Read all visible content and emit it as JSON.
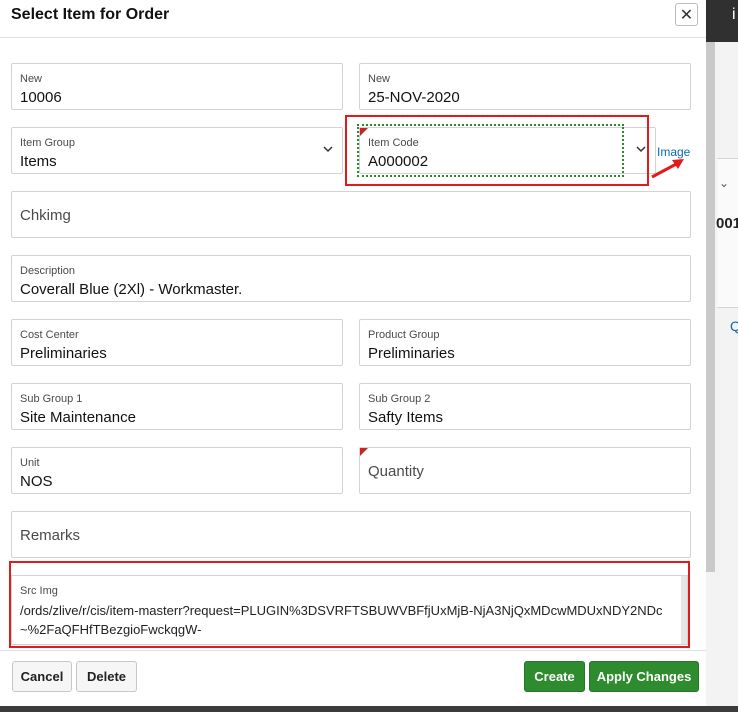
{
  "dialog": {
    "title": "Select Item for Order",
    "close_icon": "close-icon"
  },
  "fields": {
    "order_no": {
      "label": "New",
      "value": "10006"
    },
    "order_date": {
      "label": "New",
      "value": "25-NOV-2020"
    },
    "item_group": {
      "label": "Item Group",
      "value": "Items"
    },
    "item_code": {
      "label": "Item Code",
      "value": "A000002"
    },
    "image_link": "Image",
    "chkimg": {
      "label": "Chkimg"
    },
    "description": {
      "label": "Description",
      "value": "Coverall Blue (2Xl) - Workmaster."
    },
    "cost_center": {
      "label": "Cost Center",
      "value": "Preliminaries"
    },
    "product_group": {
      "label": "Product Group",
      "value": "Preliminaries"
    },
    "sub_group_1": {
      "label": "Sub Group 1",
      "value": "Site Maintenance"
    },
    "sub_group_2": {
      "label": "Sub Group 2",
      "value": "Safty Items"
    },
    "unit": {
      "label": "Unit",
      "value": "NOS"
    },
    "quantity": {
      "label": "Quantity"
    },
    "remarks": {
      "label": "Remarks"
    },
    "src_img": {
      "label": "Src Img",
      "value": "/ords/zlive/r/cis/item-masterr?request=PLUGIN%3DSVRFTSBUWVBFfjUxMjB-NjA3NjQxMDcwMDUxNDY2NDc~%2FaQFHfTBezgioFwckqgW-"
    }
  },
  "footer": {
    "cancel": "Cancel",
    "delete": "Delete",
    "create": "Create",
    "apply": "Apply Changes"
  },
  "background": {
    "partial_number": "001"
  },
  "colors": {
    "accent_green": "#2e8b2e",
    "highlight_red": "#e31a1a",
    "link_blue": "#0a6ab0"
  }
}
